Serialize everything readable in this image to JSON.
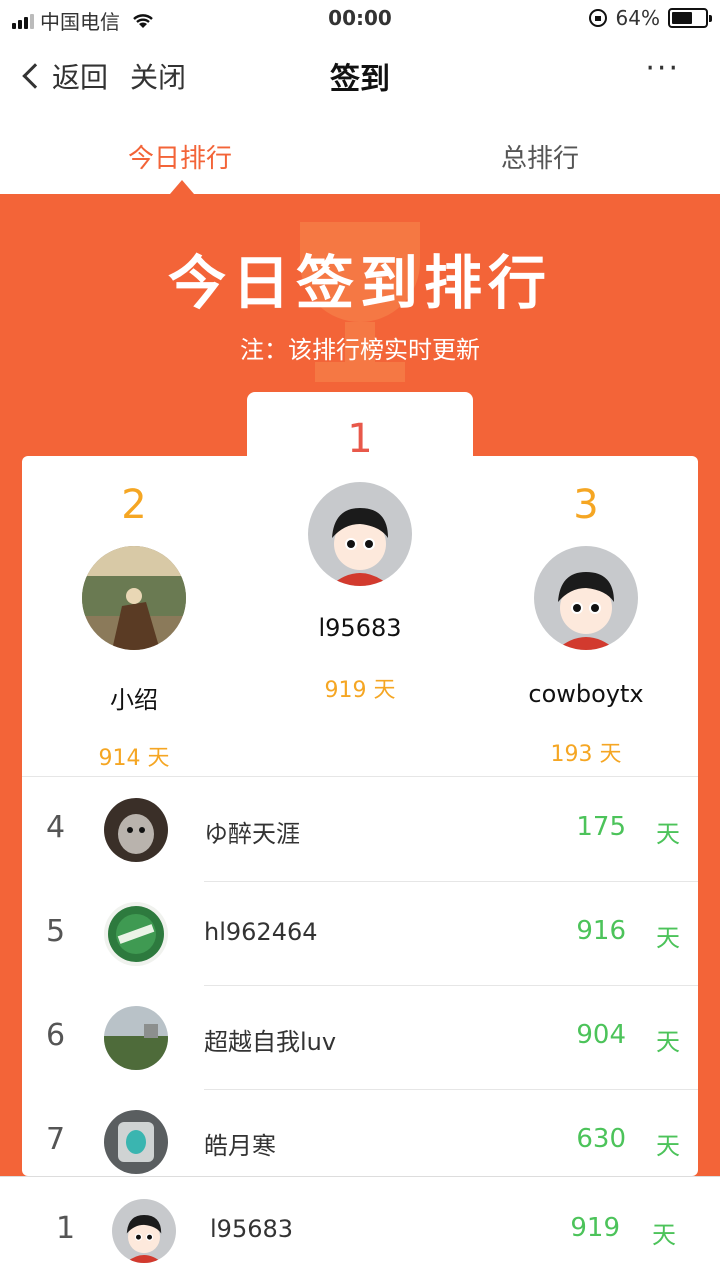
{
  "status_bar": {
    "carrier": "中国电信",
    "time": "00:00",
    "battery": "64%",
    "battery_level": 0.64
  },
  "nav": {
    "back": "返回",
    "close": "关闭",
    "title": "签到",
    "more": "···"
  },
  "tabs": [
    {
      "label": "今日排行",
      "active": true
    },
    {
      "label": "总排行",
      "active": false
    }
  ],
  "banner": {
    "title": "今日签到排行",
    "note": "注：该排行榜实时更新"
  },
  "podium": {
    "first": {
      "rank": "1",
      "name": "l95683",
      "days": "919  天"
    },
    "second": {
      "rank": "2",
      "name": "小绍",
      "days": "914  天"
    },
    "third": {
      "rank": "3",
      "name": "cowboytx",
      "days": "193  天"
    }
  },
  "list": [
    {
      "rank": "4",
      "name": "ゆ醉天涯",
      "days": "175",
      "unit": "天"
    },
    {
      "rank": "5",
      "name": "hl962464",
      "days": "916",
      "unit": "天"
    },
    {
      "rank": "6",
      "name": "超越自我luv",
      "days": "904",
      "unit": "天"
    },
    {
      "rank": "7",
      "name": "皓月寒",
      "days": "630",
      "unit": "天"
    }
  ],
  "me": {
    "rank": "1",
    "name": "l95683",
    "days": "919",
    "unit": "天"
  },
  "colors": {
    "accent": "#f36438",
    "gold": "#f5a623",
    "green": "#4cc35a",
    "first_rank": "#e8584a"
  }
}
